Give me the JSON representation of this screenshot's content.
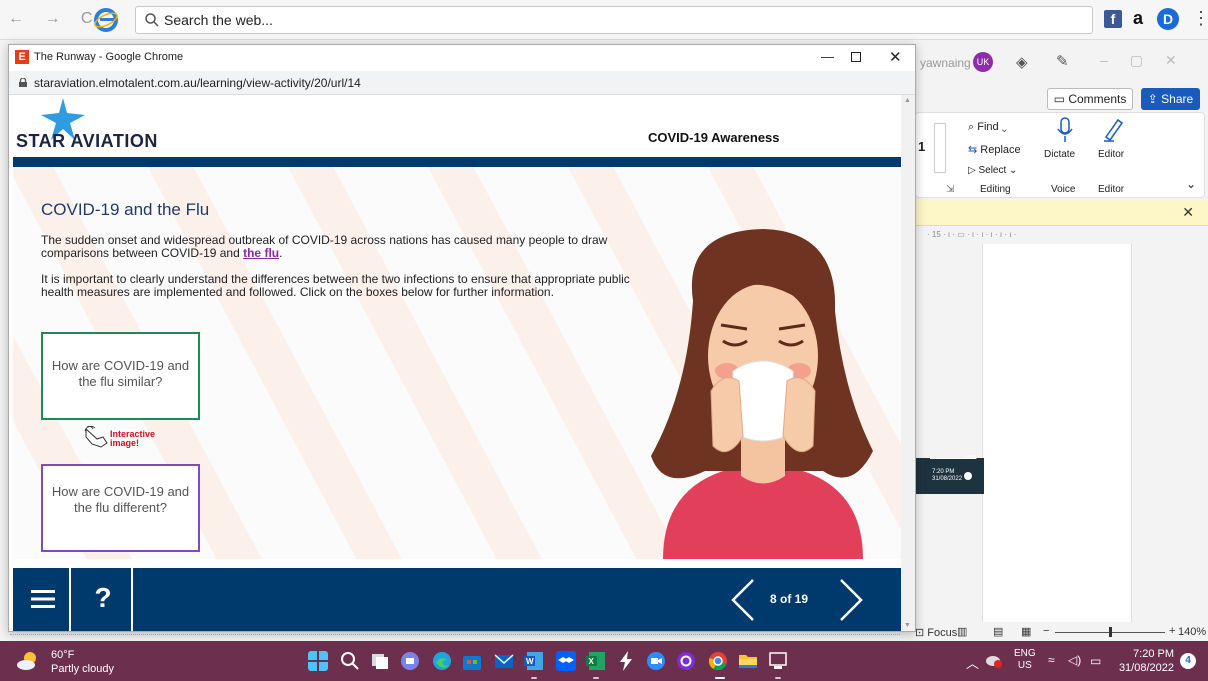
{
  "bg_browser": {
    "nav_glyphs": "← → C",
    "search_placeholder": "Search the web...",
    "fb": "f",
    "amazon": "a",
    "dl": "D",
    "kebab": "⋮"
  },
  "word": {
    "user_text": "yawnaing",
    "avatar": "UK",
    "comments_label": "Comments",
    "share_label": "Share",
    "find_label": "Find",
    "replace_label": "Replace",
    "select_label": "Select",
    "dictate_label": "Dictate",
    "editor_label": "Editor",
    "group_editing": "Editing",
    "group_voice": "Voice",
    "group_editor": "Editor",
    "ruler_text": "· 15 · ı · ▭ · ı · ı · ı · ı · ı ·",
    "status_focus": "Focus",
    "status_zoom": "140%",
    "thumb_zoom": "140%",
    "thumb_time": "7:20 PM",
    "thumb_date": "31/08/2022",
    "font_size_fragment": "1"
  },
  "chrome": {
    "favicon_letter": "E",
    "title": "The Runway - Google Chrome",
    "url": "staraviation.elmotalent.com.au/learning/view-activity/20/url/14"
  },
  "course": {
    "logo_text": "STAR AVIATION",
    "course_name": "COVID-19 Awareness",
    "slide_title": "COVID-19 and the Flu",
    "p1_before": "The sudden onset and widespread outbreak of COVID-19 across nations has caused many people to draw comparisons between COVID-19 and ",
    "p1_link": "the flu",
    "p1_after": ".",
    "p2": "It is important to clearly understand the differences between the two infections to ensure that appropriate public health measures are implemented and followed. Click on the boxes below for further information.",
    "btn_similar": "How are COVID-19 and the flu similar?",
    "btn_different": "How are COVID-19 and the flu different?",
    "interactive_line1": "Interactive",
    "interactive_line2": "image!",
    "help_glyph": "?",
    "page_count": "8 of 19"
  },
  "taskbar": {
    "weather_temp": "60°F",
    "weather_desc": "Partly cloudy",
    "lang_1": "ENG",
    "lang_2": "US",
    "time": "7:20 PM",
    "date": "31/08/2022",
    "badge": "4"
  },
  "colors": {
    "brand_navy": "#003a6c",
    "similar_border": "#1e8a5a",
    "different_border": "#7e4bb8",
    "link_purple": "#8a2aa0",
    "taskbar": "#6d2f4e"
  }
}
